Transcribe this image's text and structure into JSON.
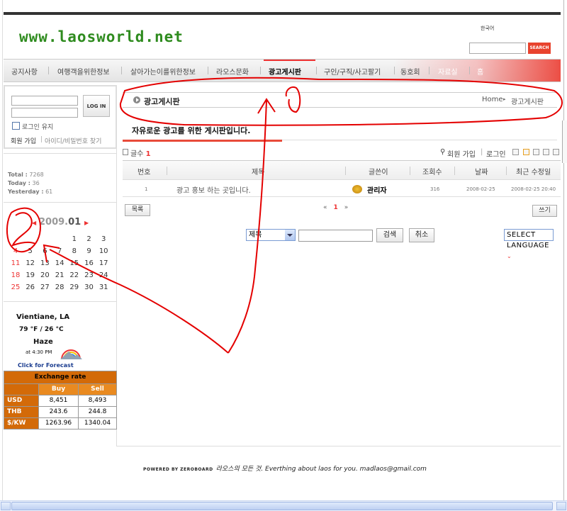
{
  "header": {
    "logo": "www.laosworld.net",
    "lang_current": "한국어",
    "lang_select": "SELECT LANGUAGE",
    "lang_arrow": "⌄",
    "search_btn": "SEARCH"
  },
  "nav": {
    "items": [
      "공지사항",
      "여행객을위한정보",
      "살아가는이를위한정보",
      "라오스문화",
      "광고게시판",
      "구인/구직/사고팔기",
      "동호회",
      "자료실",
      "홈"
    ]
  },
  "login": {
    "button": "LOG IN",
    "keep": "로그인 유지",
    "join": "회원 가입",
    "sep": "|",
    "find": "아이디/비밀번호 찾기"
  },
  "stats": {
    "total_label": "Total :",
    "total": "7268",
    "today_label": "Today :",
    "today": "36",
    "yesterday_label": "Yesterday :",
    "yesterday": "61"
  },
  "calendar": {
    "year": "2009.",
    "month": "01",
    "prev": "◀",
    "next": "▶",
    "rows": [
      [
        "",
        "",
        "",
        "",
        "1",
        "2",
        "3"
      ],
      [
        "4",
        "5",
        "6",
        "7",
        "8",
        "9",
        "10"
      ],
      [
        "11",
        "12",
        "13",
        "14",
        "15",
        "16",
        "17"
      ],
      [
        "18",
        "19",
        "20",
        "21",
        "22",
        "23",
        "24"
      ],
      [
        "25",
        "26",
        "27",
        "28",
        "29",
        "30",
        "31"
      ]
    ]
  },
  "weather": {
    "city": "Vientiane, LA",
    "temp": "79 °F / 26 °C",
    "condition": "Haze",
    "time": "at 4:30 PM",
    "link": "Click for Forecast"
  },
  "exchange": {
    "title": "Exchange rate",
    "buy": "Buy",
    "sell": "Sell",
    "rows": [
      {
        "cur": "USD",
        "buy": "8,451",
        "sell": "8,493"
      },
      {
        "cur": "THB",
        "buy": "243.6",
        "sell": "244.8"
      },
      {
        "cur": "$/KW",
        "buy": "1263.96",
        "sell": "1340.04"
      }
    ]
  },
  "board": {
    "title": "광고게시판",
    "home": "Home",
    "crumb_arrow": "▸",
    "crumb_current": "광고게시판",
    "description": "자유로운 광고를 위한 게시판입니다.",
    "count_label": "글수",
    "count": "1",
    "join": "회원 가입",
    "login": "로그인",
    "sep": "|",
    "columns": [
      "번호",
      "제목",
      "글쓴이",
      "조회수",
      "날짜",
      "최근 수정일"
    ],
    "row": {
      "no": "1",
      "subject": "광고 홍보 하는 곳입니다.",
      "writer": "관리자",
      "views": "316",
      "date": "2008-02-25",
      "modified": "2008-02-25 20:40"
    },
    "list_btn": "목록",
    "write_btn": "쓰기",
    "pager_prev": "«",
    "pager_cur": "1",
    "pager_next": "»",
    "search_field": "제목",
    "search_btn": "검색",
    "cancel_btn": "취소"
  },
  "footer": {
    "powered": "POWERED BY ZEROBOARD",
    "text": "라오스의 모든 것. Everthing about laos for you. madlaos@gmail.com"
  },
  "annotations": {
    "one": "①",
    "two": "②"
  }
}
